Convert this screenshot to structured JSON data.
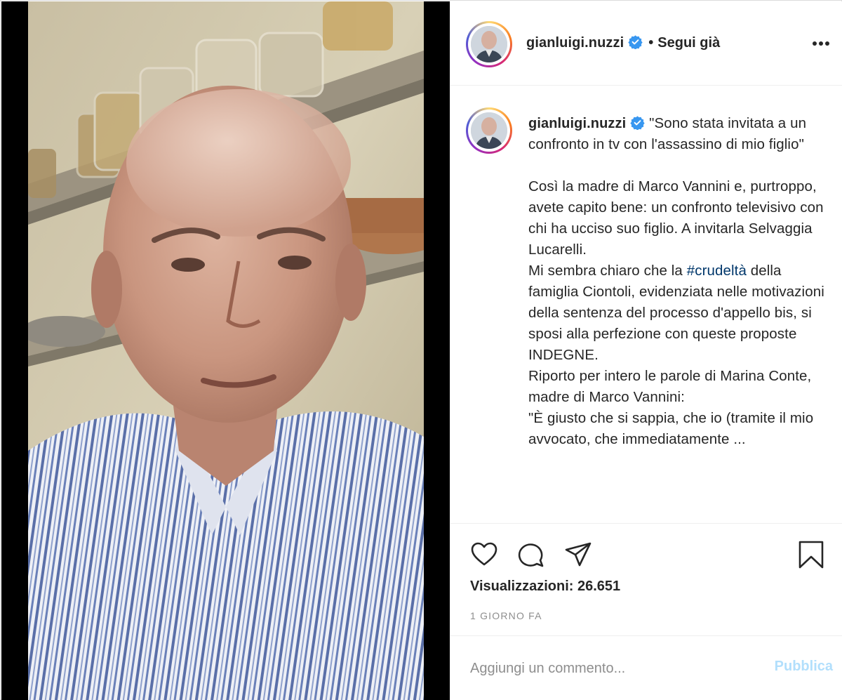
{
  "post": {
    "username": "gianluigi.nuzzi",
    "verified": true,
    "follow_separator": "•",
    "follow_status": "Segui già",
    "more_icon": "more-horizontal-icon"
  },
  "caption": {
    "username": "gianluigi.nuzzi",
    "opening_quote": "\"Sono stata invitata a un confronto in tv con l'assassino di mio figlio\"",
    "paragraph_1": "Così la madre di Marco Vannini e, purtroppo, avete capito bene: un confronto televisivo con chi ha ucciso suo figlio. A invitarla Selvaggia Lucarelli.",
    "paragraph_2_before": "Mi sembra chiaro che la ",
    "hashtag": "#crudeltà",
    "paragraph_2_after": " della famiglia Ciontoli, evidenziata nelle motivazioni della sentenza del processo d'appello bis, si sposi alla perfezione con queste proposte INDEGNE.",
    "paragraph_3": "Riporto per intero le parole di Marina Conte, madre di Marco Vannini:",
    "paragraph_4": "\"È giusto che si sappia, che io (tramite il mio avvocato, che immediatamente ..."
  },
  "actions": {
    "like_icon": "heart-icon",
    "comment_icon": "comment-icon",
    "share_icon": "paper-plane-icon",
    "save_icon": "bookmark-icon",
    "views": "Visualizzazioni: 26.651",
    "timestamp": "1 GIORNO FA"
  },
  "comment": {
    "placeholder": "Aggiungi un commento...",
    "publish_label": "Pubblica"
  },
  "colors": {
    "verified_blue": "#3897f0",
    "hashtag_link": "#00376b",
    "publish_disabled": "#b2dffc",
    "secondary_text": "#8e8e8e"
  }
}
